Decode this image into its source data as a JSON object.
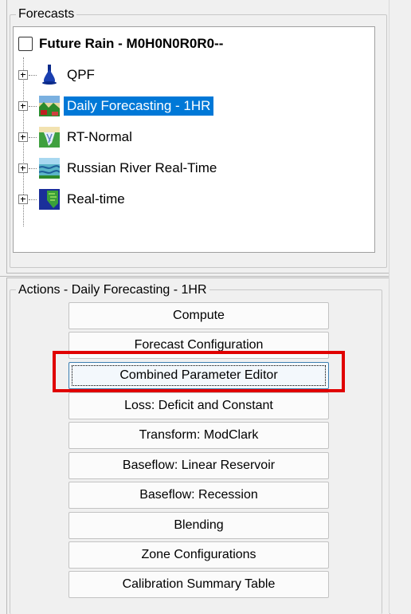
{
  "forecasts_panel": {
    "legend": "Forecasts",
    "root": {
      "label": "Future Rain - M0H0N0R0R0--",
      "checked": false
    },
    "nodes": [
      {
        "label": "QPF",
        "icon": "rain-drop-icon",
        "selected": false
      },
      {
        "label": "Daily Forecasting - 1HR",
        "icon": "landscape-forecast-icon",
        "selected": true
      },
      {
        "label": "RT-Normal",
        "icon": "flood-map-icon",
        "selected": false
      },
      {
        "label": "Russian River Real-Time",
        "icon": "river-realtime-icon",
        "selected": false
      },
      {
        "label": "Real-time",
        "icon": "grid-map-icon",
        "selected": false
      }
    ]
  },
  "actions_panel": {
    "legend": "Actions - Daily Forecasting - 1HR",
    "buttons": [
      {
        "label": "Compute"
      },
      {
        "label": "Forecast Configuration"
      },
      {
        "label": "Combined Parameter Editor",
        "focused": true,
        "highlighted": true
      },
      {
        "label": "Loss: Deficit and Constant"
      },
      {
        "label": "Transform: ModClark"
      },
      {
        "label": "Baseflow: Linear Reservoir"
      },
      {
        "label": "Baseflow: Recession"
      },
      {
        "label": "Blending"
      },
      {
        "label": "Zone Configurations"
      },
      {
        "label": "Calibration Summary Table"
      }
    ]
  },
  "colors": {
    "selection": "#0078d7",
    "highlight_box": "#e00000"
  }
}
